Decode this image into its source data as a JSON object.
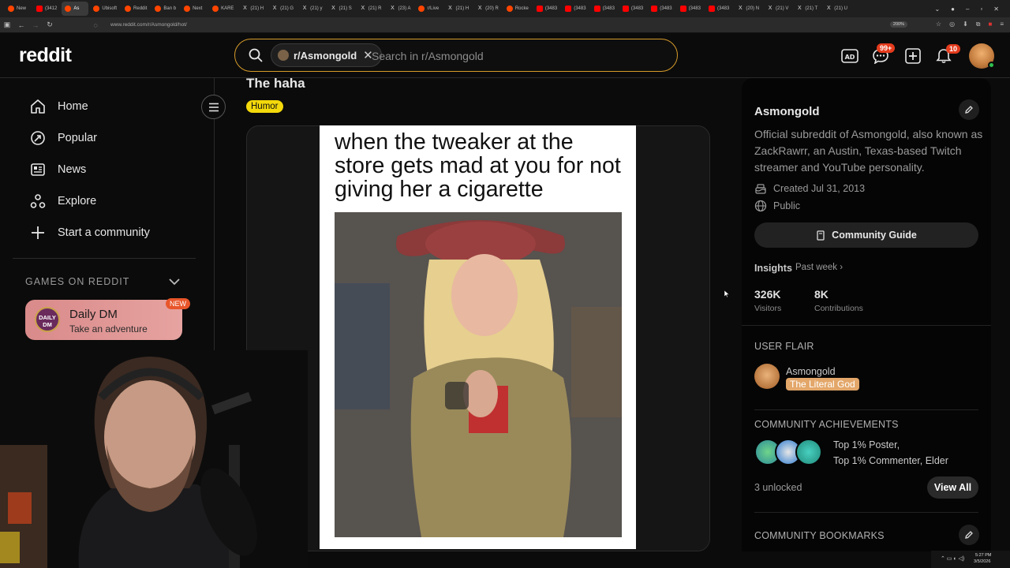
{
  "browser": {
    "tabs": [
      "New",
      "(3412",
      "As",
      "Ubisoft",
      "Reddit",
      "Ban b",
      "Next",
      "KARE",
      "(21) H",
      "(21) G",
      "(21) y",
      "(21) S",
      "(21) R",
      "(23) A",
      "r/Live",
      "(21) H",
      "(20) R",
      "Rocke",
      "(3483",
      "(3483",
      "(3483",
      "(3483",
      "(3483",
      "(3483",
      "(3483",
      "(20) N",
      "(21) V",
      "(21) T",
      "(21) U"
    ],
    "active_tab_index": 2,
    "url": "www.reddit.com/r/Asmongold/hot/",
    "zoom": "200%"
  },
  "header": {
    "logo": "reddit",
    "search_chip": "r/Asmongold",
    "search_placeholder": "Search in r/Asmongold",
    "chat_badge": "99+",
    "notif_badge": "10"
  },
  "left_sidebar": {
    "nav": [
      "Home",
      "Popular",
      "News",
      "Explore",
      "Start a community"
    ],
    "games_heading": "GAMES ON REDDIT",
    "daily_card": {
      "logo_text": "DAILY DM",
      "title": "Daily DM",
      "subtitle": "Take an adventure",
      "badge": "NEW"
    }
  },
  "post": {
    "title": "The haha",
    "flair": "Humor",
    "meme_caption": "when the tweaker at the store gets mad at you for not giving her a cigarette"
  },
  "right_sidebar": {
    "name": "Asmongold",
    "description": "Official subreddit of Asmongold, also known as ZackRawrr, an Austin, Texas-based Twitch streamer and YouTube personality.",
    "created": "Created Jul 31, 2013",
    "visibility": "Public",
    "guide_button": "Community Guide",
    "insights_label": "Insights",
    "insights_period": "Past week",
    "stats": [
      {
        "value": "326K",
        "label": "Visitors"
      },
      {
        "value": "8K",
        "label": "Contributions"
      }
    ],
    "user_flair_heading": "USER FLAIR",
    "user_name": "Asmongold",
    "user_flair": "The Literal God",
    "achievements_heading": "COMMUNITY ACHIEVEMENTS",
    "achievements_text_1": "Top 1% Poster,",
    "achievements_text_2": "Top 1% Commenter, Elder",
    "unlocked": "3 unlocked",
    "view_all": "View All",
    "bookmarks_heading": "COMMUNITY BOOKMARKS"
  },
  "taskbar": {
    "time": "5:27 PM",
    "date": "3/5/2026"
  }
}
